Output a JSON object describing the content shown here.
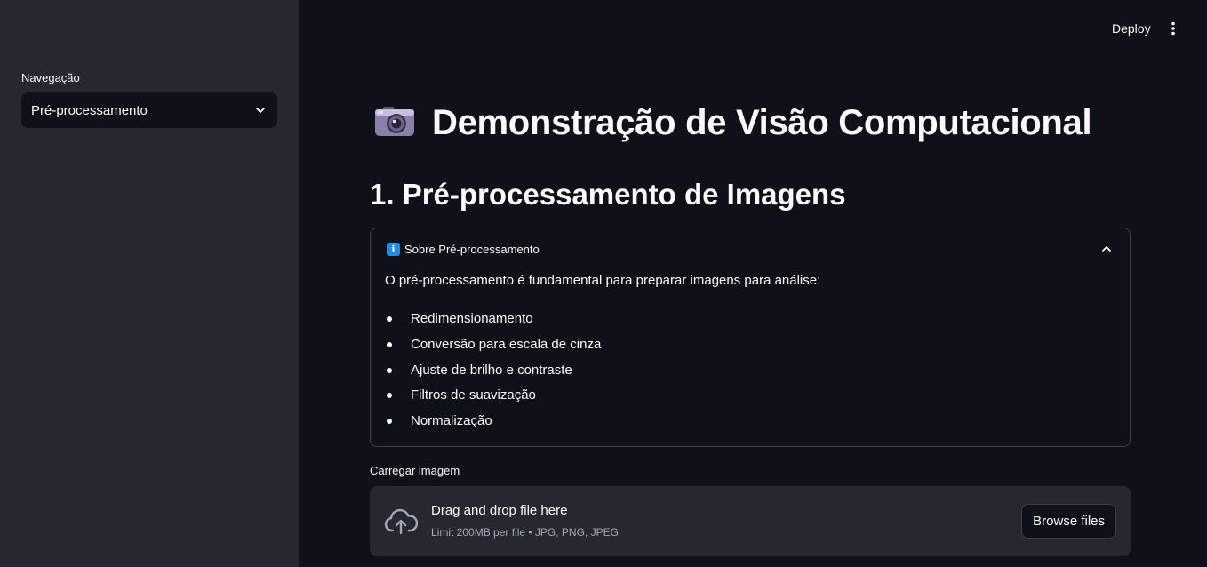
{
  "header": {
    "deploy_label": "Deploy",
    "menu_icon": "kebab-menu-icon"
  },
  "sidebar": {
    "nav_label": "Navegação",
    "nav_selected": "Pré-processamento",
    "nav_chevron_icon": "chevron-down-icon"
  },
  "main": {
    "title_icon": "camera-icon",
    "title": "Demonstração de Visão Computacional",
    "section_title": "1. Pré-processamento de Imagens",
    "expander": {
      "icon": "info-icon",
      "icon_glyph": "i",
      "title": "Sobre Pré-processamento",
      "intro": "O pré-processamento é fundamental para preparar imagens para análise:",
      "items": [
        "Redimensionamento",
        "Conversão para escala de cinza",
        "Ajuste de brilho e contraste",
        "Filtros de suavização",
        "Normalização"
      ],
      "expanded": true
    },
    "uploader": {
      "label": "Carregar imagem",
      "icon": "cloud-upload-icon",
      "title": "Drag and drop file here",
      "subtitle": "Limit 200MB per file • JPG, PNG, JPEG",
      "button_label": "Browse files"
    }
  },
  "colors": {
    "app_background": "#0e1117",
    "sidebar_background": "#262730",
    "text": "#fafafa",
    "muted_text": "#a3a8b8",
    "info_blue": "#1f8ee8"
  }
}
